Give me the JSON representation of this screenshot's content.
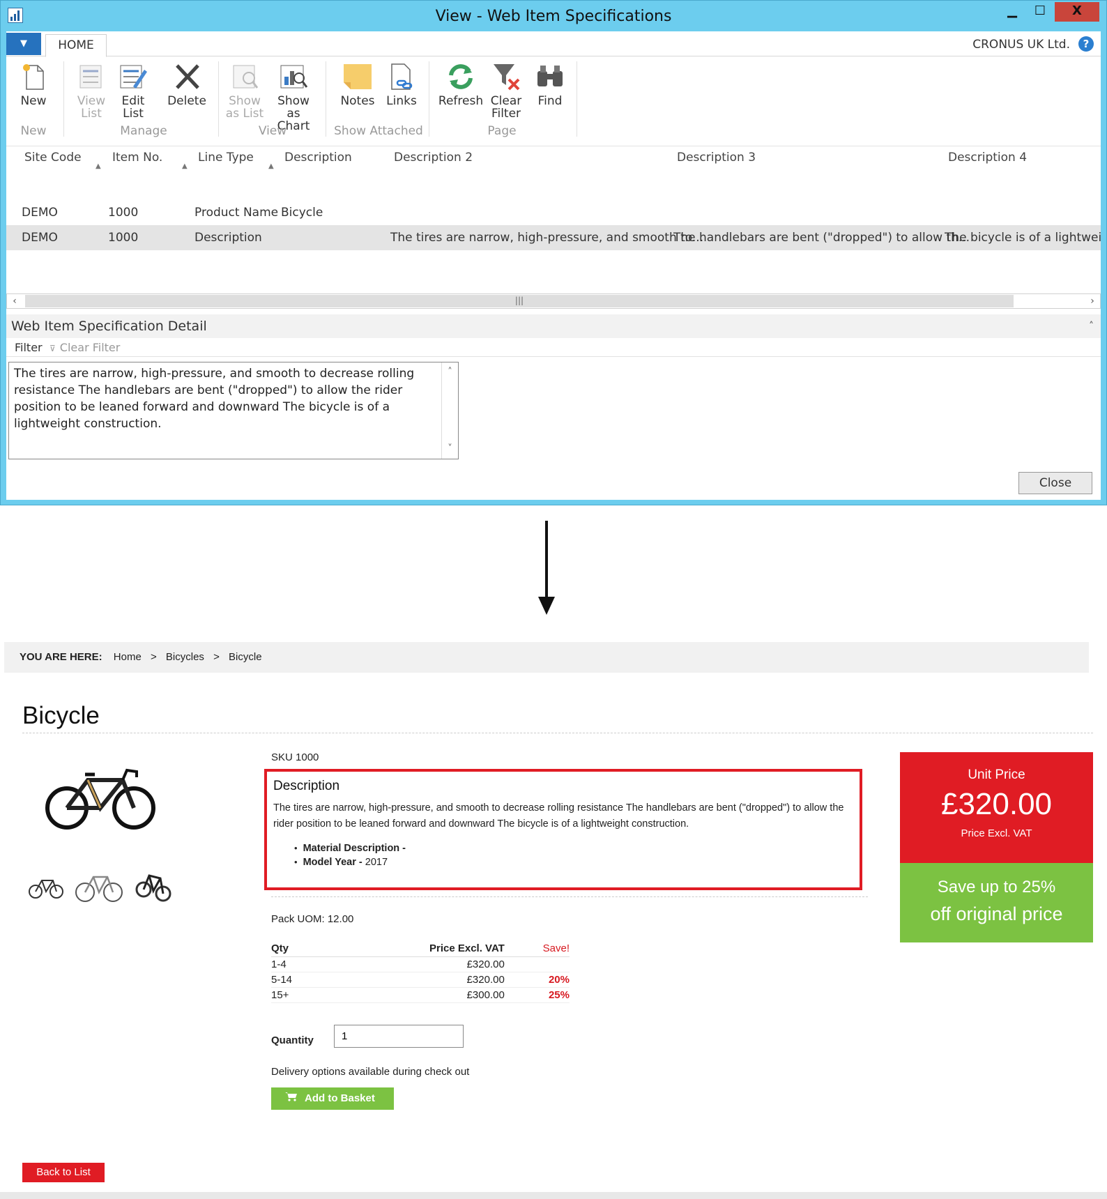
{
  "window": {
    "title": "View - Web Item Specifications",
    "min": "▁",
    "max": "☐",
    "close": "X"
  },
  "tabs": {
    "menu": "▼",
    "home": "HOME"
  },
  "company": "CRONUS UK Ltd.",
  "help": "?",
  "ribbon": {
    "new": "New",
    "view_list": [
      "View",
      "List"
    ],
    "edit_list": [
      "Edit",
      "List"
    ],
    "delete": "Delete",
    "show_as_list": [
      "Show",
      "as List"
    ],
    "show_as_chart": [
      "Show as",
      "Chart"
    ],
    "notes": "Notes",
    "links": "Links",
    "refresh": "Refresh",
    "clear_filter": [
      "Clear",
      "Filter"
    ],
    "find": "Find",
    "groups": {
      "new": "New",
      "manage": "Manage",
      "view": "View",
      "show_attached": "Show Attached",
      "page": "Page"
    }
  },
  "grid": {
    "headers": [
      "Site Code",
      "Item No.",
      "Line Type",
      "Description",
      "Description 2",
      "Description 3",
      "Description 4"
    ],
    "rows": [
      [
        "DEMO",
        "1000",
        "Product Name",
        "Bicycle",
        "",
        "",
        ""
      ],
      [
        "DEMO",
        "1000",
        "Description",
        "",
        "The tires are narrow, high-pressure, and smooth to...",
        "The handlebars are bent (\"dropped\") to allow th...",
        "The bicycle is of a lightweight"
      ]
    ]
  },
  "factbox": {
    "title": "Web Item Specification Detail",
    "filter": "Filter",
    "clear_filter": "Clear Filter",
    "text": "The tires are narrow, high-pressure, and smooth to decrease rolling resistance The handlebars are bent (\"dropped\") to allow the rider position to be leaned forward and downward The bicycle is of a lightweight construction."
  },
  "close_button": "Close",
  "web": {
    "breadcrumb": {
      "label": "YOU ARE HERE:",
      "items": [
        "Home",
        "Bicycles",
        "Bicycle"
      ],
      "sep": ">"
    },
    "title": "Bicycle",
    "sku": "SKU 1000",
    "description": {
      "heading": "Description",
      "text": "The tires are narrow, high-pressure, and smooth to decrease rolling resistance The handlebars are bent (\"dropped\") to allow the rider position to be leaned forward and downward The bicycle is of a lightweight construction.",
      "specs": [
        {
          "label": "Material Description -",
          "value": ""
        },
        {
          "label": "Model Year -",
          "value": "2017"
        }
      ]
    },
    "pack_uom": "Pack UOM: 12.00",
    "price_table": {
      "headers": [
        "Qty",
        "Price Excl. VAT",
        "Save!"
      ],
      "rows": [
        [
          "1-4",
          "£320.00",
          ""
        ],
        [
          "5-14",
          "£320.00",
          "20%"
        ],
        [
          "15+",
          "£300.00",
          "25%"
        ]
      ]
    },
    "quantity_label": "Quantity",
    "quantity_value": "1",
    "delivery": "Delivery options available during check out",
    "add_to_basket": "Add to Basket",
    "back_to_list": "Back to List",
    "price_box": {
      "unit_price_label": "Unit Price",
      "unit_price": "£320.00",
      "excl_vat": "Price Excl. VAT",
      "save_line1": "Save up to 25%",
      "save_line2": "off original price"
    }
  },
  "colors": {
    "window_frame": "#6ccdee",
    "menu_blue": "#2672be",
    "brand_red": "#e01c24",
    "brand_green": "#7cc242"
  }
}
